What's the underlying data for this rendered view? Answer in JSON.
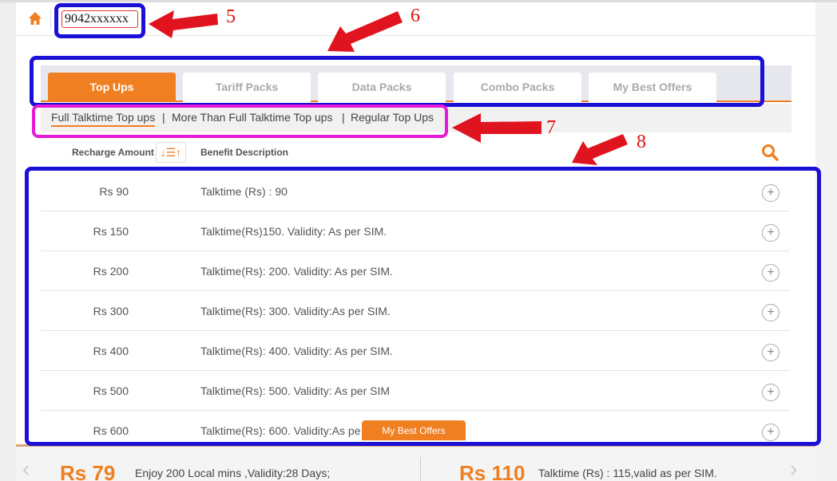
{
  "header": {
    "phone_number": "9042xxxxxx"
  },
  "tabs": [
    {
      "label": "Top Ups",
      "active": true
    },
    {
      "label": "Tariff Packs",
      "active": false
    },
    {
      "label": "Data Packs",
      "active": false
    },
    {
      "label": "Combo Packs",
      "active": false
    },
    {
      "label": "My Best Offers",
      "active": false
    }
  ],
  "subtabs": [
    {
      "label": "Full Talktime Top ups",
      "active": true
    },
    {
      "label": "More Than Full Talktime Top ups",
      "active": false
    },
    {
      "label": "Regular Top Ups",
      "active": false
    }
  ],
  "subtab_separator": "|",
  "table": {
    "col_amount": "Recharge Amount",
    "col_benefit": "Benefit Description",
    "rows": [
      {
        "amount": "Rs 90",
        "benefit": "Talktime (Rs) : 90"
      },
      {
        "amount": "Rs 150",
        "benefit": "Talktime(Rs)150. Validity: As per SIM."
      },
      {
        "amount": "Rs 200",
        "benefit": "Talktime(Rs): 200. Validity: As per SIM."
      },
      {
        "amount": "Rs 300",
        "benefit": "Talktime(Rs): 300. Validity:As per SIM."
      },
      {
        "amount": "Rs 400",
        "benefit": "Talktime(Rs): 400. Validity: As per SIM."
      },
      {
        "amount": "Rs 500",
        "benefit": "Talktime(Rs): 500. Validity: As per SIM"
      },
      {
        "amount": "Rs 600",
        "benefit": "Talktime(Rs): 600. Validity:As pe"
      }
    ]
  },
  "floating_tag": "My Best Offers",
  "carousel": [
    {
      "price": "Rs 79",
      "desc": "Enjoy 200 Local mins ,Validity:28 Days;"
    },
    {
      "price": "Rs 110",
      "desc": "Talktime (Rs) : 115,valid as per SIM."
    }
  ],
  "annotations": {
    "n5": "5",
    "n6": "6",
    "n7": "7",
    "n8": "8"
  },
  "colors": {
    "accent": "#f07f22",
    "annotation_blue": "#1a10d6",
    "annotation_magenta": "#e61ad6",
    "annotation_red": "#dd1111"
  }
}
